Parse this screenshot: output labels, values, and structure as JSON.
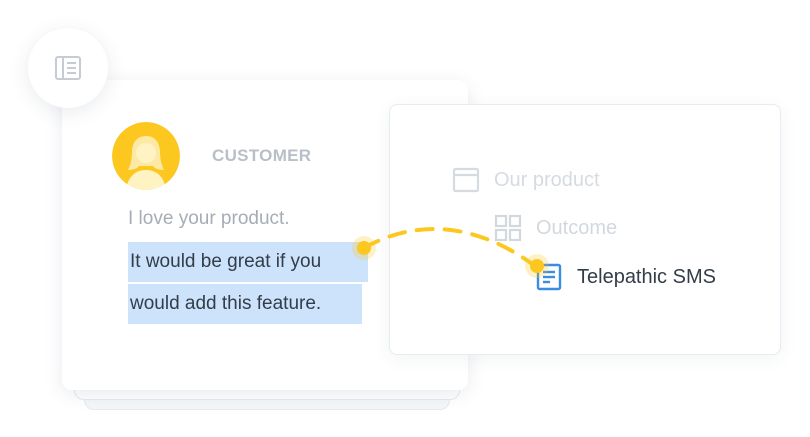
{
  "customer_card": {
    "role_label": "CUSTOMER",
    "message_plain": "I love your product.",
    "message_highlight_line1": "It would be great if you",
    "message_highlight_line2": "would add this feature."
  },
  "tree_card": {
    "items": [
      {
        "label": "Our product",
        "icon": "window-icon"
      },
      {
        "label": "Outcome",
        "icon": "grid-icon"
      },
      {
        "label": "Telepathic SMS",
        "icon": "document-icon"
      }
    ]
  },
  "colors": {
    "accent_yellow": "#fcc81f",
    "highlight": "#cde3fb",
    "icon_blue": "#3b8de0"
  }
}
